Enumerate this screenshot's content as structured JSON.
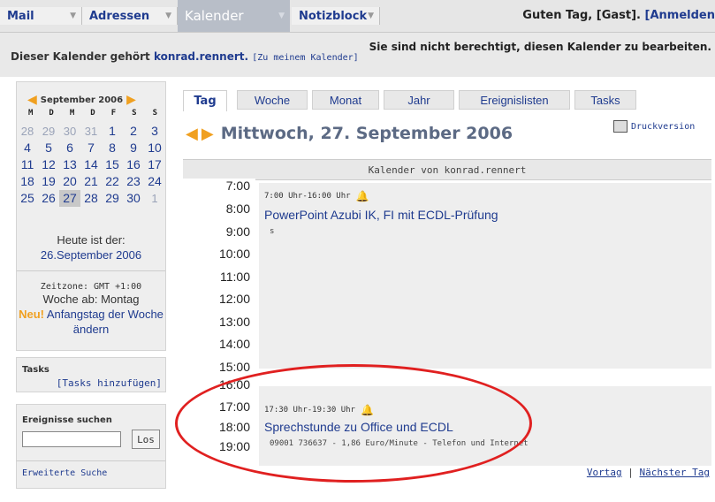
{
  "nav": {
    "tabs": [
      {
        "label": "Mail"
      },
      {
        "label": "Adressen"
      },
      {
        "label": "Kalender"
      },
      {
        "label": "Notizblock"
      }
    ],
    "greeting": "Guten Tag, [Gast].",
    "login_label": "[Anmelden"
  },
  "owner": {
    "prefix": "Dieser Kalender gehört",
    "user": "konrad.rennert.",
    "my_calendar_link": "[Zu meinem Kalender]"
  },
  "permission_notice": "Sie sind nicht berechtigt, diesen Kalender zu bearbeiten.",
  "minical": {
    "month": "September 2006",
    "weekdays": [
      "M",
      "D",
      "M",
      "D",
      "F",
      "S",
      "S"
    ],
    "rows": [
      [
        {
          "d": "28",
          "other": true
        },
        {
          "d": "29",
          "other": true
        },
        {
          "d": "30",
          "other": true
        },
        {
          "d": "31",
          "other": true
        },
        {
          "d": "1"
        },
        {
          "d": "2"
        },
        {
          "d": "3"
        }
      ],
      [
        {
          "d": "4"
        },
        {
          "d": "5"
        },
        {
          "d": "6"
        },
        {
          "d": "7"
        },
        {
          "d": "8"
        },
        {
          "d": "9"
        },
        {
          "d": "10"
        }
      ],
      [
        {
          "d": "11"
        },
        {
          "d": "12"
        },
        {
          "d": "13"
        },
        {
          "d": "14"
        },
        {
          "d": "15"
        },
        {
          "d": "16"
        },
        {
          "d": "17"
        }
      ],
      [
        {
          "d": "18"
        },
        {
          "d": "19"
        },
        {
          "d": "20"
        },
        {
          "d": "21"
        },
        {
          "d": "22"
        },
        {
          "d": "23"
        },
        {
          "d": "24"
        }
      ],
      [
        {
          "d": "25"
        },
        {
          "d": "26"
        },
        {
          "d": "27",
          "today": true
        },
        {
          "d": "28"
        },
        {
          "d": "29"
        },
        {
          "d": "30"
        },
        {
          "d": "1",
          "other": true
        }
      ]
    ]
  },
  "today": {
    "label": "Heute ist der:",
    "date": "26.September 2006",
    "timezone": "Zeitzone: GMT +1:00",
    "week_start": "Woche ab: Montag",
    "new_label": "Neu!",
    "change_link": "Anfangstag der Woche ändern"
  },
  "tasks": {
    "title": "Tasks",
    "add_link": "[Tasks hinzufügen]"
  },
  "search": {
    "title": "Ereignisse suchen",
    "input_value": "",
    "button": "Los",
    "advanced": "Erweiterte Suche"
  },
  "view_tabs": [
    {
      "label": "Tag",
      "active": true
    },
    {
      "label": "Woche"
    },
    {
      "label": "Monat"
    },
    {
      "label": "Jahr"
    },
    {
      "label": "Ereignislisten"
    },
    {
      "label": "Tasks"
    }
  ],
  "date_heading": "Mittwoch, 27. September 2006",
  "print_label": "Druckversion",
  "day": {
    "header": "Kalender von konrad.rennert",
    "hours": [
      "7:00",
      "8:00",
      "9:00",
      "10:00",
      "11:00",
      "12:00",
      "13:00",
      "14:00",
      "15:00",
      "16:00",
      "17:00",
      "18:00",
      "19:00"
    ],
    "events": [
      {
        "time": "7:00 Uhr-16:00 Uhr",
        "title": "PowerPoint Azubi IK, FI mit ECDL-Prüfung",
        "desc": "s"
      },
      {
        "time": "17:30 Uhr-19:30 Uhr",
        "title": "Sprechstunde zu Office und ECDL",
        "desc": "09001 736637 - 1,86 Euro/Minute - Telefon und Internet"
      }
    ]
  },
  "bottom_nav": {
    "prev": "Vortag",
    "sep": "|",
    "next": "Nächster Tag"
  },
  "colors": {
    "link": "#1f3b8f",
    "accent_arrow": "#f0a020",
    "annotation": "#e02020"
  }
}
